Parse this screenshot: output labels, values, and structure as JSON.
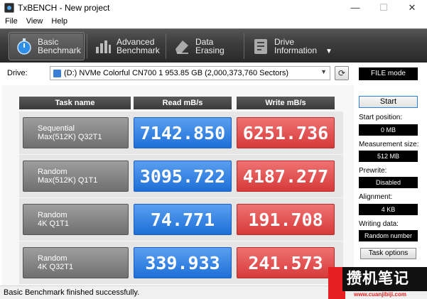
{
  "window": {
    "title": "TxBENCH - New project",
    "minimize": "—",
    "maximize": "☐",
    "close": "✕"
  },
  "menu": [
    "File",
    "View",
    "Help"
  ],
  "toolbar": {
    "tabs": [
      {
        "line1": "Basic",
        "line2": "Benchmark",
        "active": true,
        "icon": "stopwatch-icon"
      },
      {
        "line1": "Advanced",
        "line2": "Benchmark",
        "active": false,
        "icon": "bar-chart-icon"
      },
      {
        "line1": "Data Erasing",
        "line2": "",
        "active": false,
        "icon": "eraser-icon"
      },
      {
        "line1": "Drive",
        "line2": "Information",
        "active": false,
        "icon": "drive-info-icon"
      }
    ],
    "more": "▼"
  },
  "drive": {
    "label": "Drive:",
    "selected": "(D:) NVMe Colorful CN700 1  953.85 GB (2,000,373,760 Sectors)",
    "mode": "FILE mode"
  },
  "table": {
    "headers": [
      "Task name",
      "Read mB/s",
      "Write mB/s"
    ],
    "rows": [
      {
        "line1": "Sequential",
        "line2": "Max(512K) Q32T1",
        "read": "7142.850",
        "write": "6251.736"
      },
      {
        "line1": "Random",
        "line2": "Max(512K) Q1T1",
        "read": "3095.722",
        "write": "4187.277"
      },
      {
        "line1": "Random",
        "line2": "4K Q1T1",
        "read": "74.771",
        "write": "191.708"
      },
      {
        "line1": "Random",
        "line2": "4K Q32T1",
        "read": "339.933",
        "write": "241.573"
      }
    ]
  },
  "side": {
    "start": "Start",
    "start_position_label": "Start position:",
    "start_position": "0 MB",
    "measurement_size_label": "Measurement size:",
    "measurement_size": "512 MB",
    "prewrite_label": "Prewrite:",
    "prewrite": "Disabled",
    "alignment_label": "Alignment:",
    "alignment": "4 KB",
    "writing_data_label": "Writing data:",
    "writing_data": "Random number",
    "task_options": "Task options"
  },
  "status": "Basic Benchmark finished successfully.",
  "watermark": {
    "text": "攒机笔记",
    "url": "www.cuanjibiji.com"
  },
  "colors": {
    "read": "#1d6fd8",
    "write": "#d63a3a",
    "toolbar": "#3c3c3c"
  }
}
